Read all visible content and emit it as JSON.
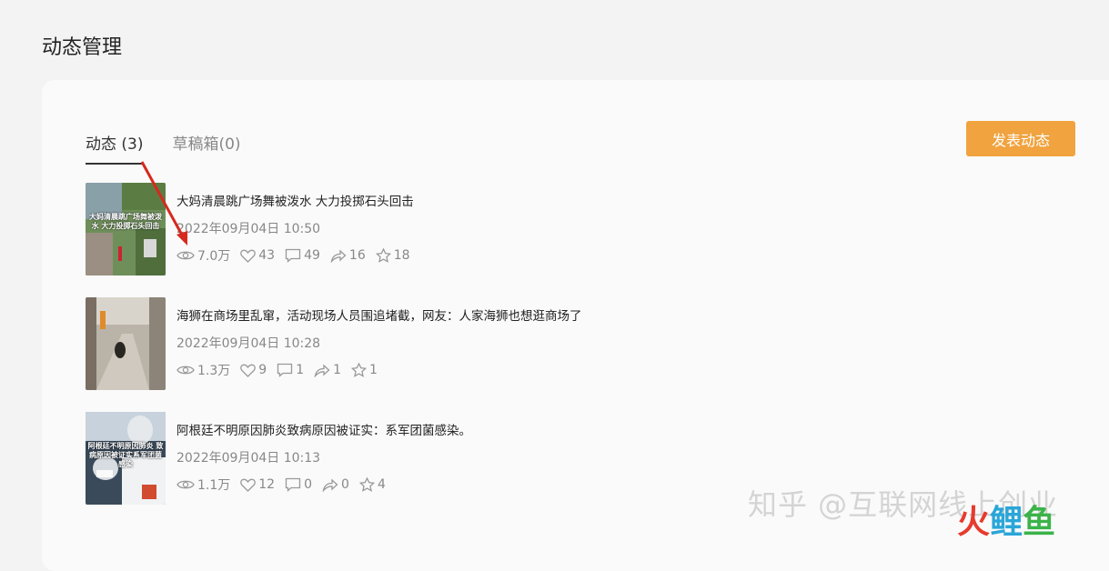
{
  "page": {
    "title": "动态管理"
  },
  "tabs": [
    {
      "label": "动态 (3)",
      "active": true
    },
    {
      "label": "草稿箱(0)",
      "active": false
    }
  ],
  "actions": {
    "publish_label": "发表动态",
    "accent_color": "#f0a33f"
  },
  "feed": [
    {
      "title": "大妈清晨跳广场舞被泼水 大力投掷石头回击",
      "time": "2022年09月04日 10:50",
      "thumb_text": "大妈清晨跳广场舞被泼水 大力投掷石头回击",
      "stats": {
        "views": "7.0万",
        "likes": "43",
        "comments": "49",
        "shares": "16",
        "favorites": "18"
      }
    },
    {
      "title": "海狮在商场里乱窜，活动现场人员围追堵截，网友：人家海狮也想逛商场了",
      "time": "2022年09月04日 10:28",
      "thumb_text": "",
      "stats": {
        "views": "1.3万",
        "likes": "9",
        "comments": "1",
        "shares": "1",
        "favorites": "1"
      }
    },
    {
      "title": "阿根廷不明原因肺炎致病原因被证实：系军团菌感染。",
      "time": "2022年09月04日 10:13",
      "thumb_text": "阿根廷不明原因肺炎 致病原因被证实系军团菌感染",
      "stats": {
        "views": "1.1万",
        "likes": "12",
        "comments": "0",
        "shares": "0",
        "favorites": "4"
      }
    }
  ],
  "icons": [
    "eye-icon",
    "heart-icon",
    "comment-icon",
    "share-icon",
    "star-icon"
  ],
  "watermark": {
    "text": "知乎 @互联网线上创业",
    "logo_parts": [
      "火",
      "鲤",
      "鱼"
    ]
  }
}
